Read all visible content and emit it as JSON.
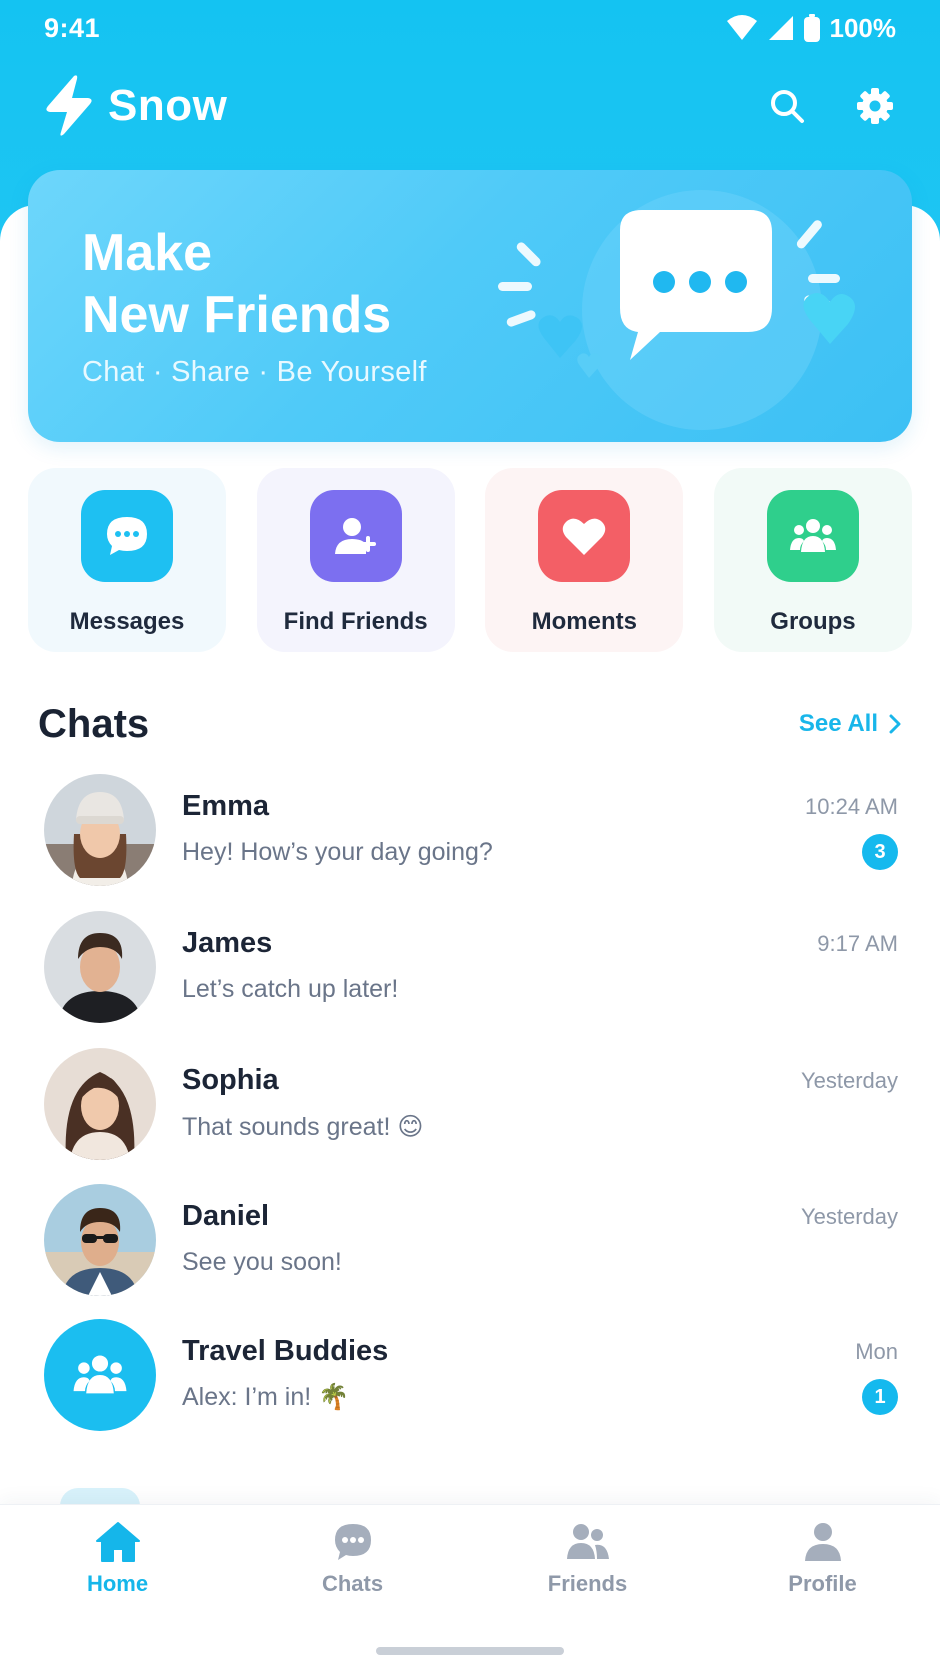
{
  "status_bar": {
    "time": "9:41",
    "battery": "100%"
  },
  "header": {
    "app_name": "Snow"
  },
  "hero": {
    "title_line1": "Make",
    "title_line2": "New Friends",
    "subtitle": "Chat · Share · Be Yourself"
  },
  "quick_actions": [
    {
      "label": "Messages",
      "icon": "chat-bubble-icon",
      "color": "#1ec0f2"
    },
    {
      "label": "Find Friends",
      "icon": "add-user-icon",
      "color": "#7c6ff0"
    },
    {
      "label": "Moments",
      "icon": "heart-icon",
      "color": "#f35f66"
    },
    {
      "label": "Groups",
      "icon": "group-icon",
      "color": "#2fcf8c"
    }
  ],
  "chats_section": {
    "title": "Chats",
    "see_all": "See All"
  },
  "chats": [
    {
      "name": "Emma",
      "preview": "Hey! How’s your day going?",
      "time": "10:24 AM",
      "unread": "3"
    },
    {
      "name": "James",
      "preview": "Let’s catch up later!",
      "time": "9:17 AM"
    },
    {
      "name": "Sophia",
      "preview": "That sounds great! 😊",
      "time": "Yesterday"
    },
    {
      "name": "Daniel",
      "preview": "See you soon!",
      "time": "Yesterday"
    },
    {
      "name": "Travel Buddies",
      "preview": "Alex: I’m in! 🌴",
      "time": "Mon",
      "unread": "1"
    }
  ],
  "bottom_nav": [
    {
      "label": "Home",
      "icon": "home-icon",
      "active": true
    },
    {
      "label": "Chats",
      "icon": "chats-icon"
    },
    {
      "label": "Friends",
      "icon": "friends-icon"
    },
    {
      "label": "Profile",
      "icon": "profile-icon"
    }
  ],
  "colors": {
    "accent": "#15b9ee",
    "header_bg": "#14c3f2"
  }
}
